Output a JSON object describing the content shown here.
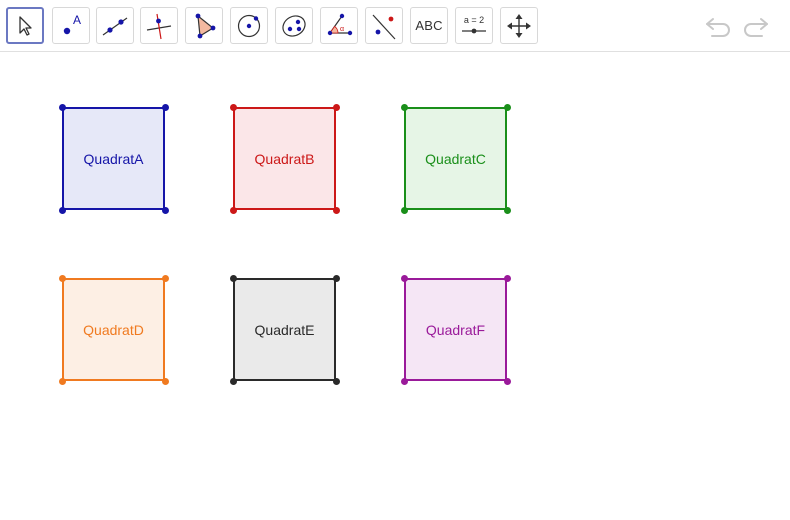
{
  "toolbar": {
    "tools": [
      {
        "name": "move-tool",
        "icon": "arrow-cursor-icon"
      },
      {
        "name": "point-tool",
        "icon": "point-icon",
        "glyph": "A"
      },
      {
        "name": "line-tool",
        "icon": "line-through-two-points-icon"
      },
      {
        "name": "perpendicular-line-tool",
        "icon": "perpendicular-line-icon"
      },
      {
        "name": "polygon-tool",
        "icon": "polygon-icon"
      },
      {
        "name": "circle-tool",
        "icon": "circle-center-point-icon"
      },
      {
        "name": "ellipse-tool",
        "icon": "ellipse-icon"
      },
      {
        "name": "angle-tool",
        "icon": "angle-icon",
        "glyph": "α"
      },
      {
        "name": "reflect-tool",
        "icon": "reflect-about-line-icon"
      },
      {
        "name": "text-tool",
        "icon": "text-icon",
        "label": "ABC"
      },
      {
        "name": "slider-tool",
        "icon": "slider-icon",
        "label": "a = 2"
      },
      {
        "name": "move-graphics-view-tool",
        "icon": "move-graphics-view-icon"
      }
    ],
    "selected_tool": "move-tool",
    "undo_icon": "undo-icon",
    "redo_icon": "redo-icon"
  },
  "squares": [
    {
      "label": "QuadratA",
      "color": "#1515a8",
      "fill": "#e6e8f8"
    },
    {
      "label": "QuadratB",
      "color": "#cc1818",
      "fill": "#fbe6e8"
    },
    {
      "label": "QuadratC",
      "color": "#1a8f1a",
      "fill": "#e6f5e6"
    },
    {
      "label": "QuadratD",
      "color": "#f07a20",
      "fill": "#fdefe4"
    },
    {
      "label": "QuadratE",
      "color": "#2a2a2a",
      "fill": "#eaeaea"
    },
    {
      "label": "QuadratF",
      "color": "#9a1a9a",
      "fill": "#f5e6f5"
    }
  ]
}
